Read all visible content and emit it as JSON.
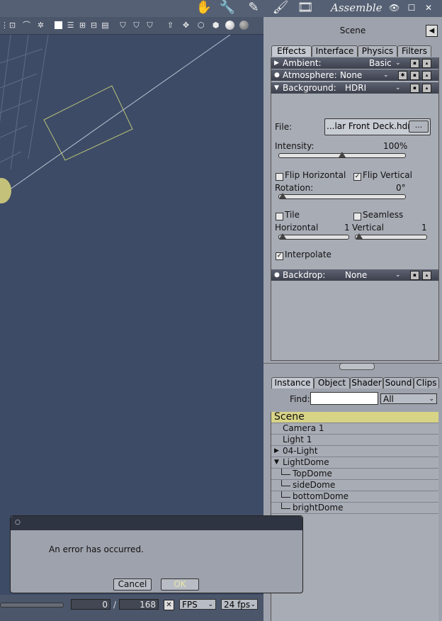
{
  "app": {
    "mode_title": "Assemble",
    "colors": {
      "viewport_bg": "#3d4b66",
      "panel_bg": "#9ea2ac",
      "selection": "#d8d486"
    }
  },
  "toolbar": {
    "icons": [
      "hierarchy-icon",
      "camera-icon",
      "target-icon",
      "layout-single-icon",
      "layout-rows-icon",
      "layout-grid-icon",
      "layout-split-icon",
      "shield-a-icon",
      "shield-b-icon",
      "shield-c-icon",
      "arrow-up-icon",
      "move-icon",
      "wireframe-cube-icon",
      "solid-cube-icon",
      "sphere-icon",
      "shaded-sphere-icon"
    ]
  },
  "panel": {
    "title": "Scene",
    "tabs": [
      {
        "label": "Effects",
        "active": true
      },
      {
        "label": "Interface",
        "active": false
      },
      {
        "label": "Physics",
        "active": false
      },
      {
        "label": "Filters",
        "active": false
      }
    ],
    "ambient": {
      "label": "Ambient:",
      "value": "Basic"
    },
    "atmosphere": {
      "label": "Atmosphere:",
      "value": "None"
    },
    "background": {
      "label": "Background:",
      "value": "HDRI"
    },
    "file": {
      "label": "File:",
      "value": "...lar Front Deck.hdr",
      "browse": "..."
    },
    "intensity": {
      "label": "Intensity:",
      "value": "100%",
      "level": 0.5
    },
    "flip_horizontal": {
      "label": "Flip Horizontal",
      "checked": false
    },
    "flip_vertical": {
      "label": "Flip Vertical",
      "checked": true
    },
    "rotation": {
      "label": "Rotation:",
      "value": "0°",
      "level": 0.0
    },
    "tile": {
      "label": "Tile",
      "checked": false
    },
    "seamless": {
      "label": "Seamless",
      "checked": false
    },
    "horizontal": {
      "label": "Horizontal",
      "value": "1"
    },
    "vertical": {
      "label": "Vertical",
      "value": "1"
    },
    "interpolate": {
      "label": "Interpolate",
      "checked": true
    },
    "backdrop": {
      "label": "Backdrop:",
      "value": "None"
    }
  },
  "lower_panel": {
    "tabs": [
      {
        "label": "Instance",
        "active": true
      },
      {
        "label": "Object",
        "active": false
      },
      {
        "label": "Shader",
        "active": false
      },
      {
        "label": "Sound",
        "active": false
      },
      {
        "label": "Clips",
        "active": false
      }
    ],
    "find_label": "Find:",
    "find_value": "",
    "filter": "All",
    "items": [
      {
        "label": "Scene",
        "depth": 0,
        "selected": true,
        "expander": ""
      },
      {
        "label": "Camera 1",
        "depth": 1,
        "selected": false,
        "expander": ""
      },
      {
        "label": "Light 1",
        "depth": 1,
        "selected": false,
        "expander": ""
      },
      {
        "label": "04-Light",
        "depth": 1,
        "selected": false,
        "expander": "collapsed"
      },
      {
        "label": "LightDome",
        "depth": 1,
        "selected": false,
        "expander": "expanded"
      },
      {
        "label": "TopDome",
        "depth": 2,
        "selected": false,
        "expander": ""
      },
      {
        "label": "sideDome",
        "depth": 2,
        "selected": false,
        "expander": ""
      },
      {
        "label": "bottomDome",
        "depth": 2,
        "selected": false,
        "expander": ""
      },
      {
        "label": "brightDome",
        "depth": 2,
        "selected": false,
        "expander": ""
      }
    ]
  },
  "dialog": {
    "message": "An error has occurred.",
    "cancel": "Cancel",
    "ok": "OK"
  },
  "timeline": {
    "current_frame": "0",
    "separator": "/",
    "total_frames": "168",
    "unit": "FPS",
    "rate": "24 fps"
  }
}
